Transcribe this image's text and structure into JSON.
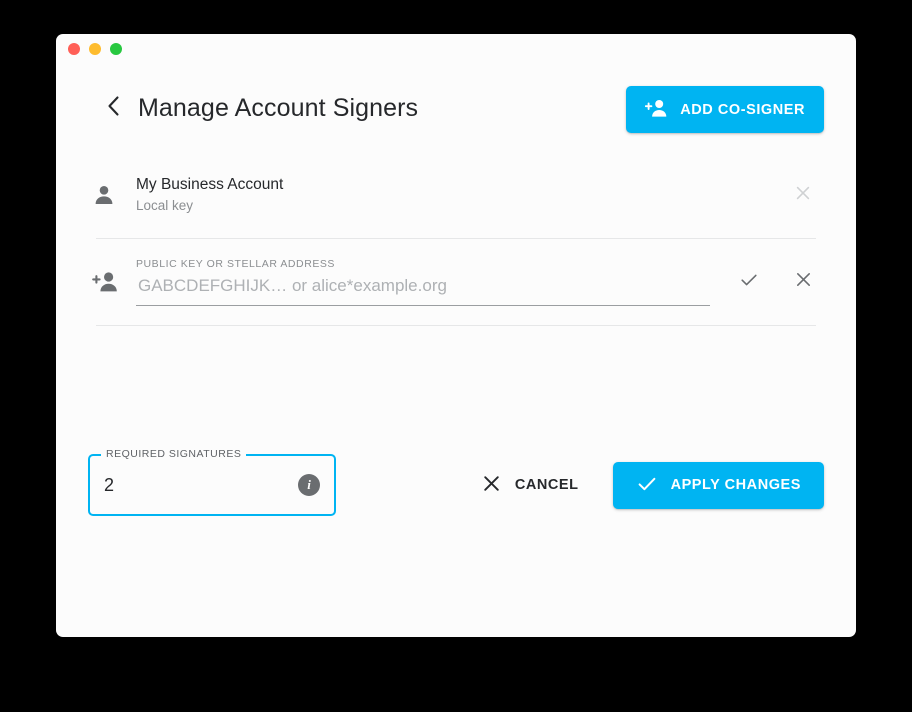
{
  "window": {
    "traffic_lights": [
      {
        "name": "close",
        "color": "#ff5f57"
      },
      {
        "name": "minimize",
        "color": "#febc2e"
      },
      {
        "name": "zoom",
        "color": "#28c840"
      }
    ]
  },
  "header": {
    "back_icon": "chevron-left-icon",
    "title": "Manage Account Signers",
    "add_cosigner": {
      "label": "ADD CO-SIGNER",
      "icon": "person-add-icon",
      "color": "#00b4f2"
    }
  },
  "signers": [
    {
      "icon": "person-icon",
      "name": "My Business Account",
      "subtitle": "Local key",
      "remove_icon": "close-icon"
    }
  ],
  "new_signer": {
    "icon": "person-add-icon",
    "label": "PUBLIC KEY OR STELLAR ADDRESS",
    "value": "",
    "placeholder": "GABCDEFGHIJK… or alice*example.org",
    "confirm_icon": "check-icon",
    "cancel_icon": "close-icon"
  },
  "footer": {
    "required_signatures": {
      "legend": "REQUIRED SIGNATURES",
      "value": "2",
      "placeholder": "",
      "info_icon": "info-icon",
      "accent": "#00b4f2"
    },
    "cancel": {
      "label": "CANCEL",
      "icon": "close-icon"
    },
    "apply": {
      "label": "APPLY CHANGES",
      "icon": "check-icon",
      "color": "#00b4f2"
    }
  }
}
